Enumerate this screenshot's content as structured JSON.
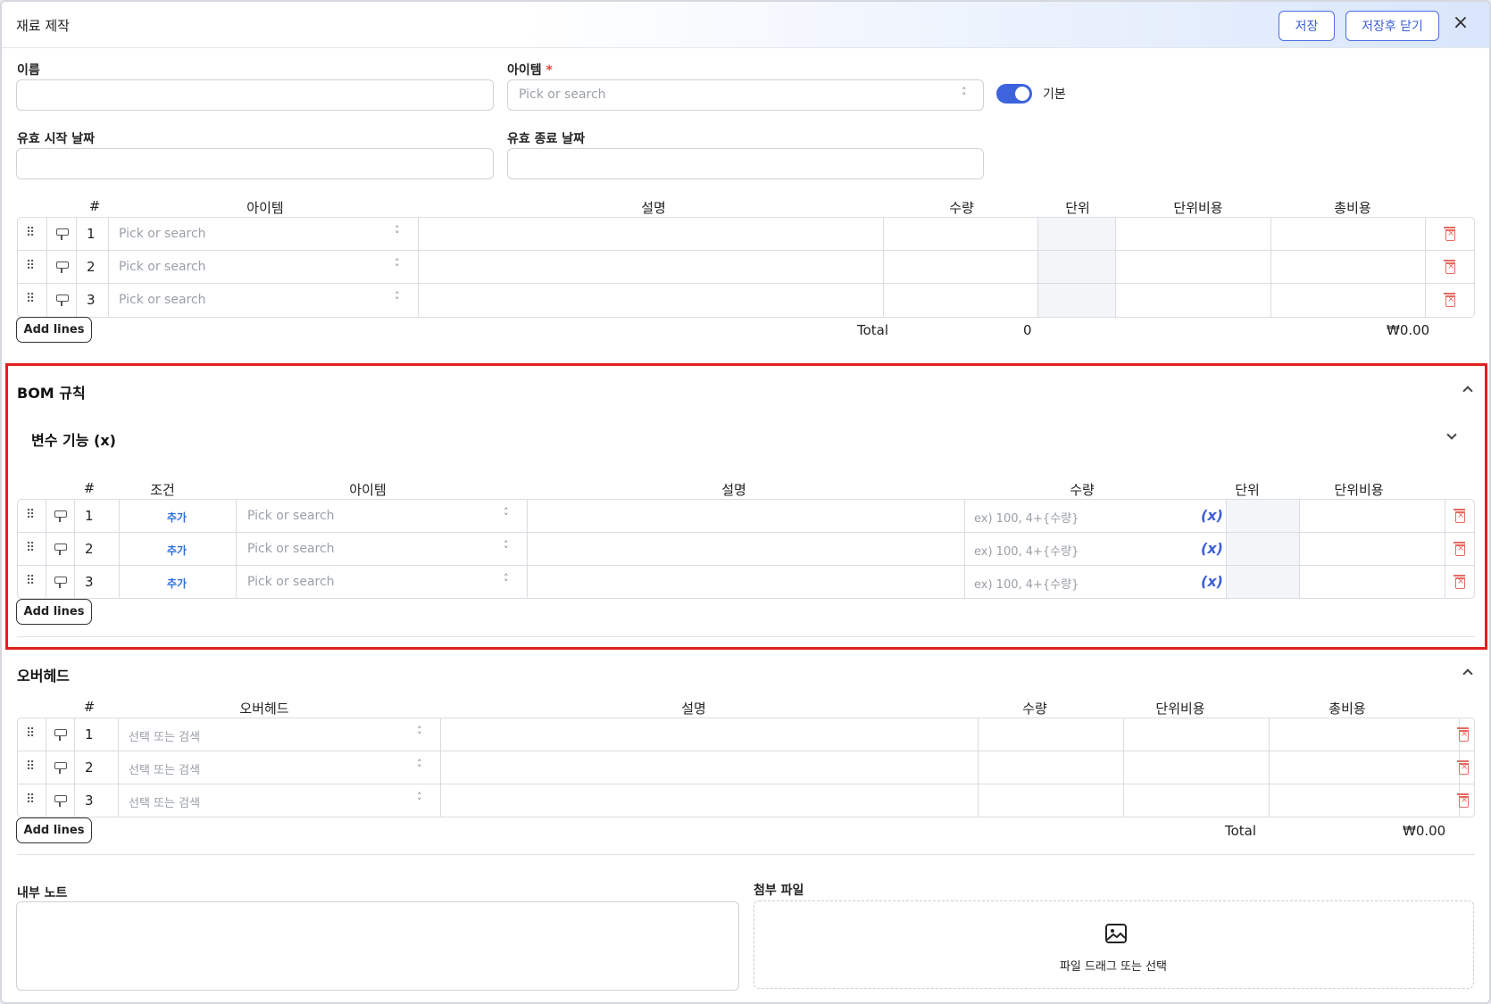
{
  "header": {
    "title": "재료 제작",
    "save_label": "저장",
    "save_close_label": "저장후 닫기",
    "close_icon": "×"
  },
  "form": {
    "name_label": "이름",
    "item_label": "아이템",
    "required_mark": "*",
    "item_placeholder": "Pick or search",
    "default_toggle_label": "기본",
    "default_toggle_on": true,
    "valid_from_label": "유효 시작 날짜",
    "valid_to_label": "유효 종료 날짜"
  },
  "materials": {
    "headers": [
      "#",
      "아이템",
      "설명",
      "수량",
      "단위",
      "단위비용",
      "총비용"
    ],
    "rows": [
      {
        "num": "1",
        "item_placeholder": "Pick or search"
      },
      {
        "num": "2",
        "item_placeholder": "Pick or search"
      },
      {
        "num": "3",
        "item_placeholder": "Pick or search"
      }
    ],
    "add_lines": "Add lines",
    "total_label": "Total",
    "total_qty": "0",
    "total_cost": "₩0.00"
  },
  "bom": {
    "title": "BOM 규칙",
    "variables_title": "변수 기능 (x)",
    "headers": [
      "#",
      "조건",
      "아이템",
      "설명",
      "수량",
      "단위",
      "단위비용"
    ],
    "rows": [
      {
        "num": "1",
        "condition": "추가",
        "item_placeholder": "Pick or search",
        "qty_placeholder": "ex) 100, 4+{수량}",
        "fx": "(x)"
      },
      {
        "num": "2",
        "condition": "추가",
        "item_placeholder": "Pick or search",
        "qty_placeholder": "ex) 100, 4+{수량}",
        "fx": "(x)"
      },
      {
        "num": "3",
        "condition": "추가",
        "item_placeholder": "Pick or search",
        "qty_placeholder": "ex) 100, 4+{수량}",
        "fx": "(x)"
      }
    ],
    "add_lines": "Add lines"
  },
  "overhead": {
    "title": "오버헤드",
    "headers": [
      "#",
      "오버헤드",
      "설명",
      "수량",
      "단위비용",
      "총비용"
    ],
    "rows": [
      {
        "num": "1",
        "placeholder": "선택 또는 검색"
      },
      {
        "num": "2",
        "placeholder": "선택 또는 검색"
      },
      {
        "num": "3",
        "placeholder": "선택 또는 검색"
      }
    ],
    "add_lines": "Add lines",
    "total_label": "Total",
    "total_cost": "₩0.00"
  },
  "notes": {
    "label": "내부 노트"
  },
  "attachments": {
    "label": "첨부 파일",
    "dropzone_text": "파일 드래그 또는 선택",
    "icon": "image-icon"
  }
}
